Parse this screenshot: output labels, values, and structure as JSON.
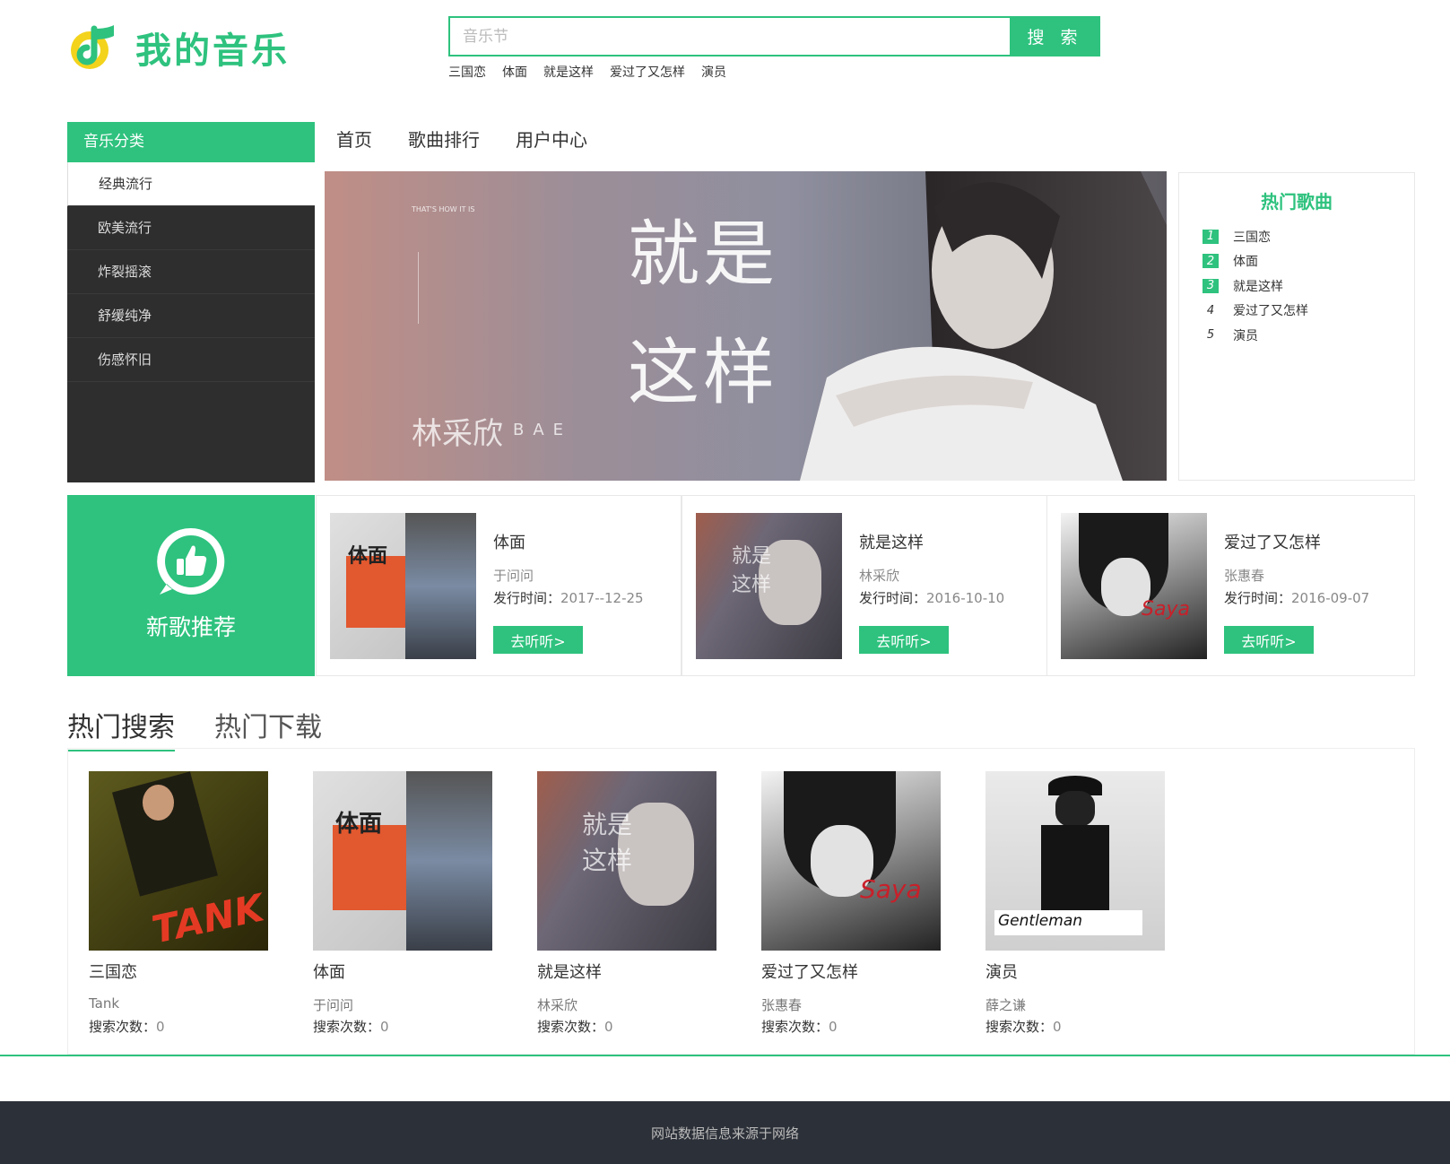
{
  "header": {
    "logo_text": "我的音乐",
    "search_placeholder": "音乐节",
    "search_button": "搜 索",
    "hot_keywords": [
      "三国恋",
      "体面",
      "就是这样",
      "爱过了又怎样",
      "演员"
    ]
  },
  "sidebar": {
    "title": "音乐分类",
    "items": [
      {
        "label": "经典流行",
        "active": true
      },
      {
        "label": "欧美流行",
        "active": false
      },
      {
        "label": "炸裂摇滚",
        "active": false
      },
      {
        "label": "舒缓纯净",
        "active": false
      },
      {
        "label": "伤感怀旧",
        "active": false
      }
    ]
  },
  "nav": {
    "items": [
      "首页",
      "歌曲排行",
      "用户中心"
    ]
  },
  "banner": {
    "title_line1": "就是",
    "title_line2": "这样",
    "artist_cn": "林采欣",
    "artist_en": "BAE",
    "small_text": "THAT'S HOW IT IS"
  },
  "hot_songs": {
    "title": "热门歌曲",
    "items": [
      {
        "rank": "1",
        "name": "三国恋"
      },
      {
        "rank": "2",
        "name": "体面"
      },
      {
        "rank": "3",
        "name": "就是这样"
      },
      {
        "rank": "4",
        "name": "爱过了又怎样"
      },
      {
        "rank": "5",
        "name": "演员"
      }
    ]
  },
  "new_songs": {
    "title": "新歌推荐",
    "date_label": "发行时间：",
    "listen_label": "去听听>",
    "cards": [
      {
        "name": "体面",
        "artist": "于问问",
        "date": "2017--12-25",
        "cover_text": "体面"
      },
      {
        "name": "就是这样",
        "artist": "林采欣",
        "date": "2016-10-10",
        "cover_text": "就是这样"
      },
      {
        "name": "爱过了又怎样",
        "artist": "张惠春",
        "date": "2016-09-07",
        "cover_text": "Saya"
      }
    ]
  },
  "tabs": {
    "items": [
      "热门搜索",
      "热门下载"
    ]
  },
  "hot_search": {
    "count_label": "搜索次数：",
    "albums": [
      {
        "name": "三国恋",
        "artist": "Tank",
        "count": "0",
        "cover_text": "TANK"
      },
      {
        "name": "体面",
        "artist": "于问问",
        "count": "0",
        "cover_text": "体面"
      },
      {
        "name": "就是这样",
        "artist": "林采欣",
        "count": "0",
        "cover_text": "就是这样"
      },
      {
        "name": "爱过了又怎样",
        "artist": "张惠春",
        "count": "0",
        "cover_text": "Saya"
      },
      {
        "name": "演员",
        "artist": "薛之谦",
        "count": "0",
        "cover_text": "Gentleman"
      }
    ]
  },
  "footer": {
    "text": "网站数据信息来源于网络"
  },
  "colors": {
    "brand": "#2ec27e",
    "sidebar_bg": "#2e2e2e",
    "footer_bg": "#2c3038"
  }
}
